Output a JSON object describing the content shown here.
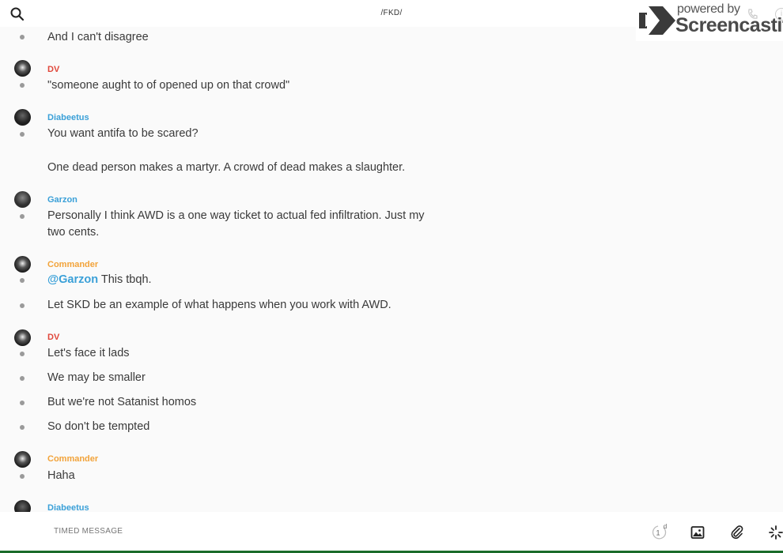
{
  "header": {
    "title": "/FKD/",
    "search_icon": "search-icon"
  },
  "watermark": {
    "powered": "powered by",
    "brand": "Screencastify"
  },
  "messages": [
    {
      "text": "And I can't disagree"
    },
    {
      "author": "DV",
      "author_color": "#e0473a",
      "text": "\"someone aught to of opened up on that crowd\""
    },
    {
      "author": "Diabeetus",
      "author_color": "#3aa0d8",
      "text": "You want antifa to be scared?",
      "text2": "One dead person makes a martyr. A crowd of dead makes a slaughter."
    },
    {
      "author": "Garzon",
      "author_color": "#3aa0d8",
      "text": "Personally I think AWD is a one way ticket to actual fed infiltration. Just my two cents."
    },
    {
      "author": "Commander",
      "author_color": "#f2a33a",
      "mention": "@Garzon",
      "text": " This tbqh.",
      "text2": "Let SKD be an example of what happens when you work with AWD."
    },
    {
      "author": "DV",
      "author_color": "#e0473a",
      "lines": [
        "Let's face it lads",
        "We may be smaller",
        "But we're not Satanist homos",
        "So don't be tempted"
      ]
    },
    {
      "author": "Commander",
      "author_color": "#f2a33a",
      "text": "Haha"
    },
    {
      "author": "Diabeetus",
      "author_color": "#3aa0d8"
    }
  ],
  "composer": {
    "placeholder": "TIMED MESSAGE",
    "timer_value": "1",
    "timer_unit": "d"
  }
}
